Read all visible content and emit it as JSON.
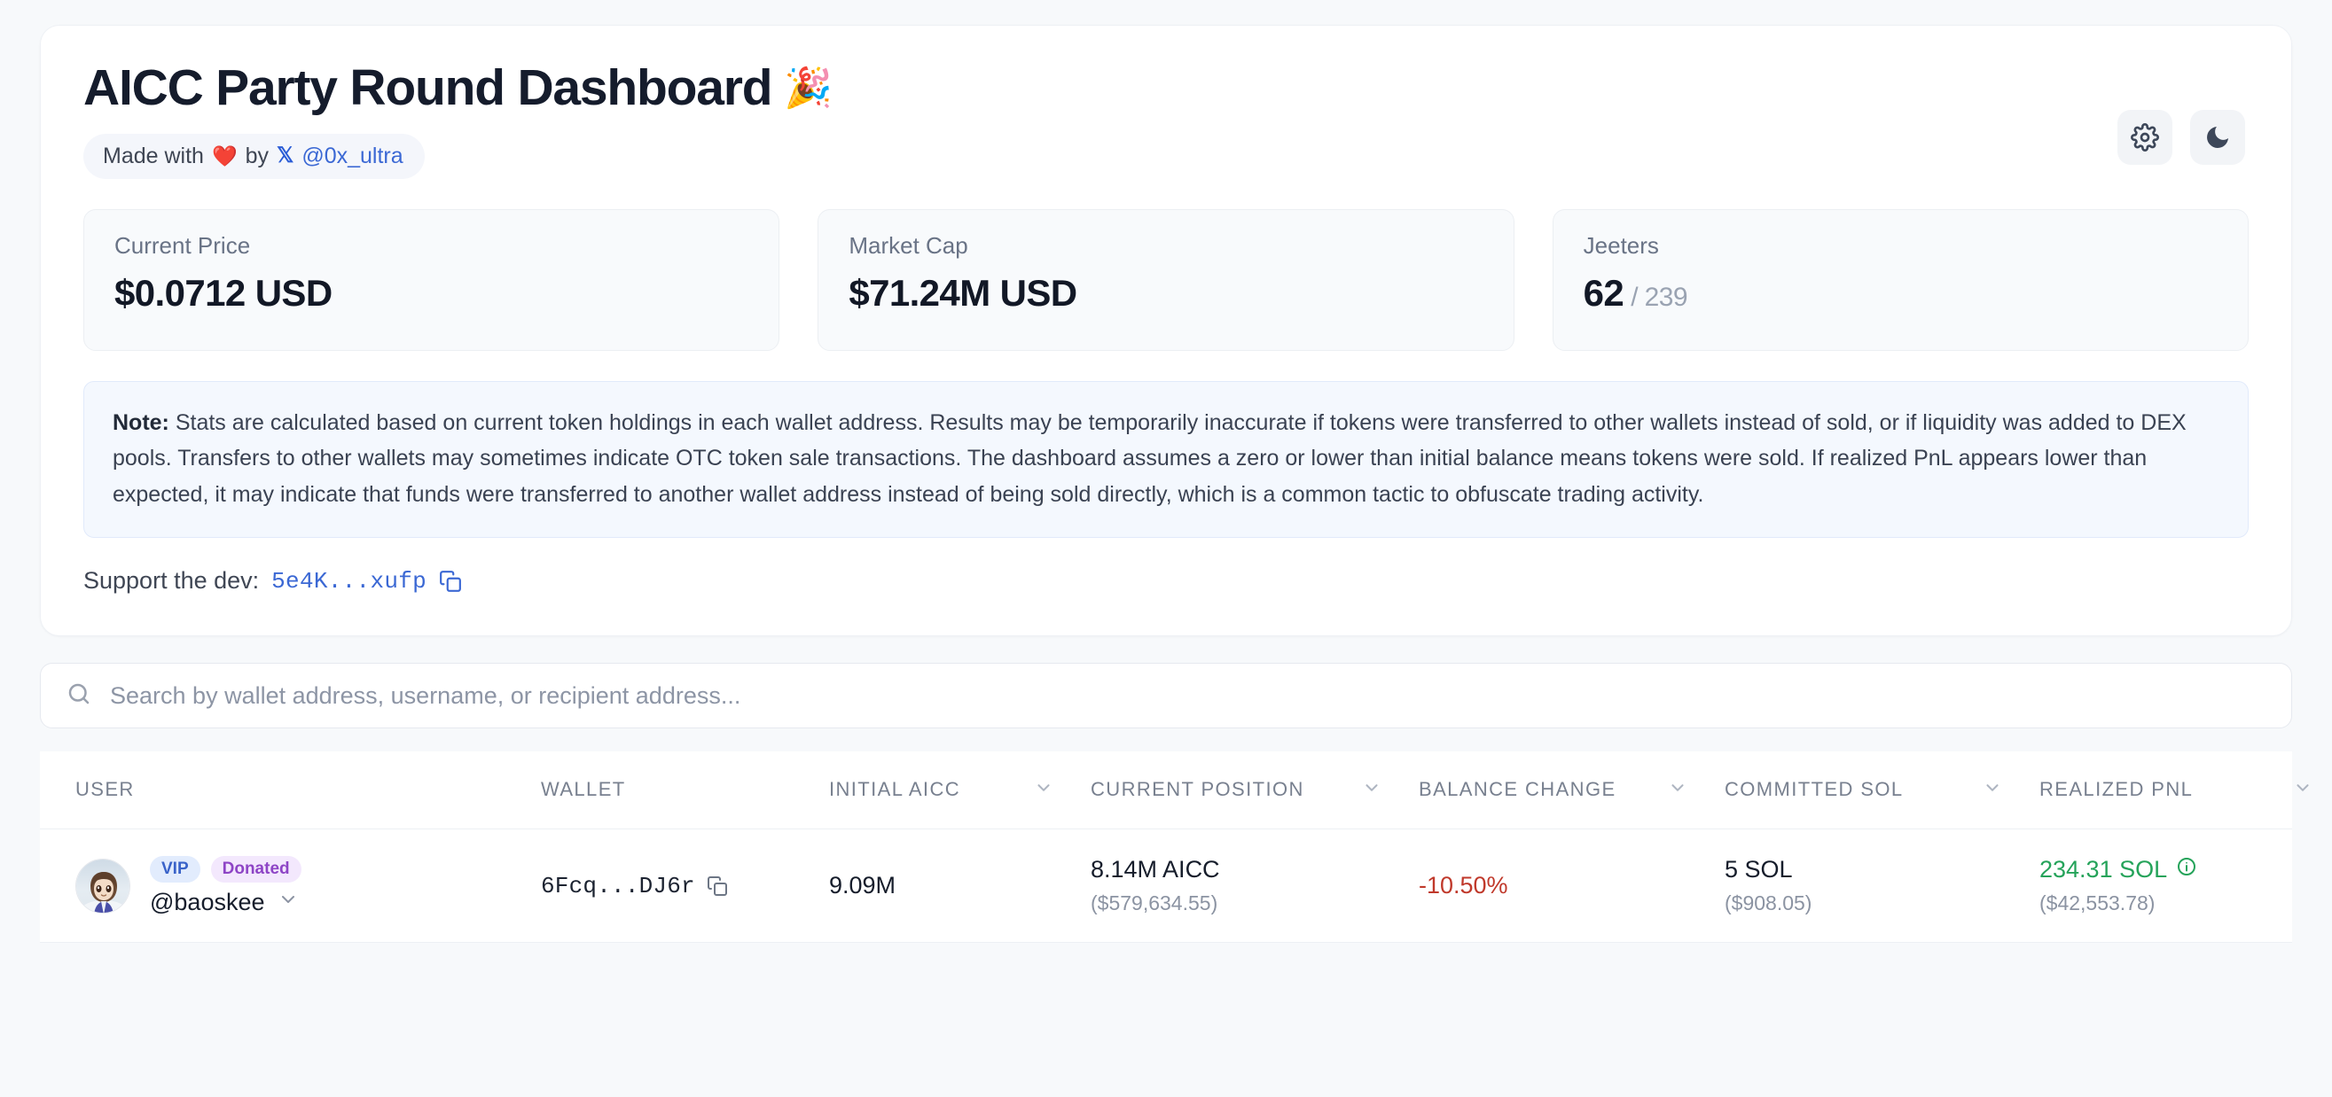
{
  "header": {
    "title": "AICC Party Round Dashboard",
    "title_emoji": "🎉",
    "made_with_prefix": "Made with",
    "made_with_heart": "❤️",
    "made_with_by": "by",
    "x_glyph": "𝕏",
    "handle": "@0x_ultra",
    "settings_icon": "gear-icon",
    "theme_icon": "moon-icon"
  },
  "stats": [
    {
      "label": "Current Price",
      "value": "$0.0712 USD",
      "sub": ""
    },
    {
      "label": "Market Cap",
      "value": "$71.24M USD",
      "sub": ""
    },
    {
      "label": "Jeeters",
      "value": "62",
      "sub": "/ 239"
    }
  ],
  "note": {
    "prefix": "Note:",
    "body": " Stats are calculated based on current token holdings in each wallet address. Results may be temporarily inaccurate if tokens were transferred to other wallets instead of sold, or if liquidity was added to DEX pools. Transfers to other wallets may sometimes indicate OTC token sale transactions. The dashboard assumes a zero or lower than initial balance means tokens were sold. If realized PnL appears lower than expected, it may indicate that funds were transferred to another wallet address instead of being sold directly, which is a common tactic to obfuscate trading activity."
  },
  "support": {
    "label": "Support the dev:",
    "address": "5e4K...xufp",
    "copy_icon": "copy-icon"
  },
  "search": {
    "placeholder": "Search by wallet address, username, or recipient address...",
    "value": "",
    "icon": "search-icon"
  },
  "table": {
    "columns": [
      {
        "label": "USER",
        "sortable": false
      },
      {
        "label": "WALLET",
        "sortable": false
      },
      {
        "label": "INITIAL AICC",
        "sortable": true
      },
      {
        "label": "CURRENT POSITION",
        "sortable": true
      },
      {
        "label": "BALANCE CHANGE",
        "sortable": true
      },
      {
        "label": "COMMITTED SOL",
        "sortable": true
      },
      {
        "label": "REALIZED PNL",
        "sortable": true
      }
    ],
    "rows": [
      {
        "tags": [
          "VIP",
          "Donated"
        ],
        "username": "@baoskee",
        "wallet": "6Fcq...DJ6r",
        "initial_aicc": "9.09M",
        "current_position": "8.14M AICC",
        "current_position_usd": "($579,634.55)",
        "balance_change": "-10.50%",
        "committed_sol": "5 SOL",
        "committed_sol_usd": "($908.05)",
        "realized_pnl": "234.31 SOL",
        "realized_pnl_usd": "($42,553.78)"
      }
    ]
  },
  "colors": {
    "page_bg": "#f7f9fb",
    "accent_blue": "#3b68d4",
    "negative": "#c0392b",
    "positive": "#25a35a",
    "tag_vip_bg": "#e2ecfd",
    "tag_donated_bg": "#f3e8fd"
  }
}
